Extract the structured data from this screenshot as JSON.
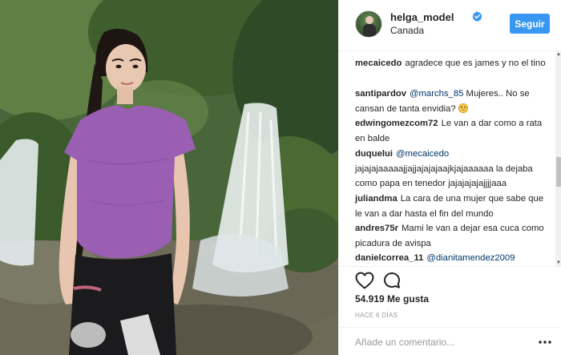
{
  "post": {
    "username": "helga_model",
    "location": "Canada",
    "follow_label": "Seguir",
    "verified_icon": "verified-badge-icon",
    "accent_color": "#3897f0"
  },
  "comments": [
    {
      "user": "mecaicedo",
      "text": "agradece que es james y no el tino"
    },
    {
      "user": "santipardov",
      "mention": "@marchs_85",
      "text": " Mujeres.. No se cansan de tanta envidia? ",
      "emoji": "grinning-face-emoji"
    },
    {
      "user": "edwingomezcom72",
      "text": "Le van a dar como a rata en balde"
    },
    {
      "user": "duquelui",
      "mention": "@mecaicedo",
      "text": " jajajajaaaaajjajjajajajaajkjajaaaaaa la dejaba como papa en tenedor jajajajajajjjjaaa"
    },
    {
      "user": "juliandma",
      "text": "La cara de una mujer que sabe que le van a dar hasta el fin del mundo"
    },
    {
      "user": "andres75r",
      "text": "Mami le van a dejar esa cuca como picadura de avispa"
    },
    {
      "user": "danielcorrea_11",
      "mention": "@dianitamendez2009",
      "text": ""
    }
  ],
  "actions": {
    "like_icon": "heart-icon",
    "comment_icon": "comment-bubble-icon",
    "likes_text": "54.919 Me gusta",
    "timestamp": "HACE 6 DÍAS",
    "add_comment_placeholder": "Añade un comentario...",
    "more_icon": "more-options-icon"
  }
}
